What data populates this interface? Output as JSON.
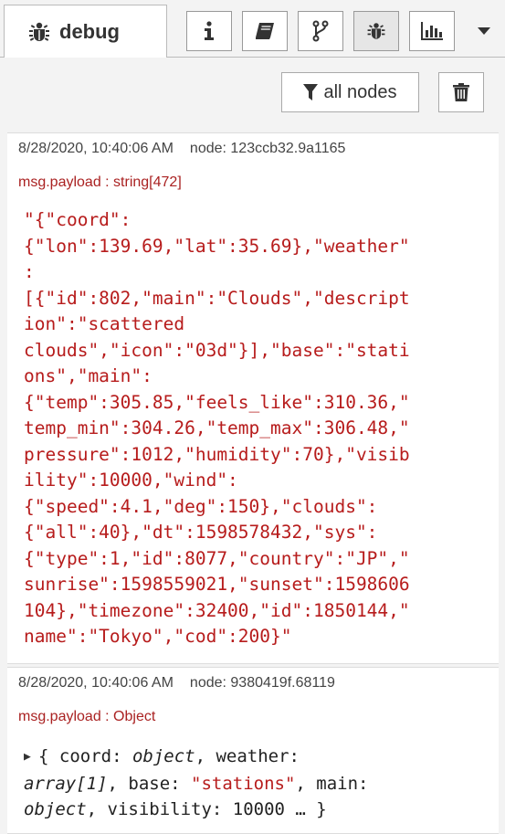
{
  "sidebar": {
    "debug_tab_label": "debug",
    "tab_icons": [
      "bug-icon"
    ],
    "buttons": [
      {
        "name": "info",
        "icon": "info-icon"
      },
      {
        "name": "help",
        "icon": "book-icon"
      },
      {
        "name": "context",
        "icon": "branch-icon"
      },
      {
        "name": "debug",
        "icon": "bug-icon",
        "active": true
      },
      {
        "name": "dashboard",
        "icon": "bar-chart-icon"
      }
    ],
    "menu_icon": "chevron-down-icon"
  },
  "toolbar": {
    "filter_label": "all nodes",
    "filter_icon": "filter-icon",
    "clear_icon": "trash-icon"
  },
  "messages": [
    {
      "timestamp": "8/28/2020, 10:40:06 AM",
      "node": "node: 123ccb32.9a1165",
      "type": "msg.payload : string[472]",
      "lines": [
        "\"{\"coord\":",
        "{\"lon\":139.69,\"lat\":35.69},\"weather\"",
        ":",
        "[{\"id\":802,\"main\":\"Clouds\",\"descript",
        "ion\":\"scattered",
        "clouds\",\"icon\":\"03d\"}],\"base\":\"stati",
        "ons\",\"main\":",
        "{\"temp\":305.85,\"feels_like\":310.36,\"",
        "temp_min\":304.26,\"temp_max\":306.48,\"",
        "pressure\":1012,\"humidity\":70},\"visib",
        "ility\":10000,\"wind\":",
        "{\"speed\":4.1,\"deg\":150},\"clouds\":",
        "{\"all\":40},\"dt\":1598578432,\"sys\":",
        "{\"type\":1,\"id\":8077,\"country\":\"JP\",\"",
        "sunrise\":1598559021,\"sunset\":1598606",
        "104},\"timezone\":32400,\"id\":1850144,\"",
        "name\":\"Tokyo\",\"cod\":200}\""
      ]
    },
    {
      "timestamp": "8/28/2020, 10:40:06 AM",
      "node": "node: 9380419f.68119",
      "type": "msg.payload : Object",
      "preview": {
        "open": "{ coord: ",
        "coord_val": "object",
        "sep1": ", weather:",
        "weather_val": "array[1]",
        "sep2": ", base: ",
        "base_val": "\"stations\"",
        "sep3": ", main:",
        "main_val": "object",
        "sep4": ", visibility: 10000 … }"
      }
    }
  ]
}
